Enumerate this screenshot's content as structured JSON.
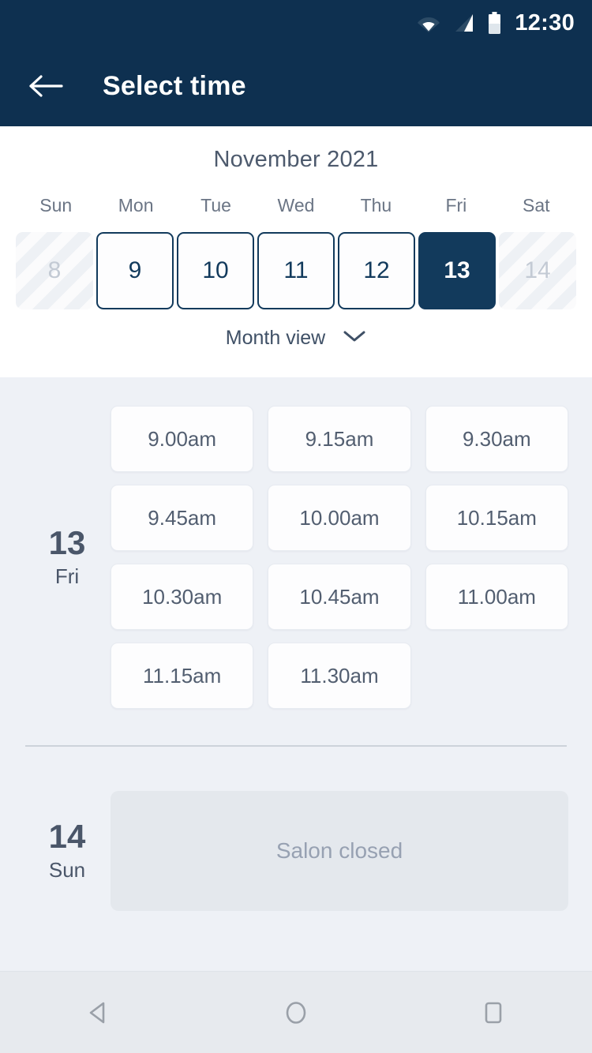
{
  "status_bar": {
    "time": "12:30",
    "icons": [
      "wifi-icon",
      "signal-icon",
      "battery-icon"
    ]
  },
  "app_bar": {
    "back_icon": "arrow-left-icon",
    "title": "Select time"
  },
  "calendar": {
    "month_label": "November 2021",
    "weekdays": [
      "Sun",
      "Mon",
      "Tue",
      "Wed",
      "Thu",
      "Fri",
      "Sat"
    ],
    "dates": [
      {
        "day": "8",
        "state": "disabled"
      },
      {
        "day": "9",
        "state": "outlined"
      },
      {
        "day": "10",
        "state": "outlined"
      },
      {
        "day": "11",
        "state": "outlined"
      },
      {
        "day": "12",
        "state": "outlined"
      },
      {
        "day": "13",
        "state": "selected"
      },
      {
        "day": "14",
        "state": "disabled"
      }
    ],
    "view_toggle_label": "Month view",
    "view_toggle_icon": "chevron-down-icon"
  },
  "schedule": [
    {
      "day_number": "13",
      "day_name": "Fri",
      "slots": [
        "9.00am",
        "9.15am",
        "9.30am",
        "9.45am",
        "10.00am",
        "10.15am",
        "10.30am",
        "10.45am",
        "11.00am",
        "11.15am",
        "11.30am"
      ]
    },
    {
      "day_number": "14",
      "day_name": "Sun",
      "closed_message": "Salon closed"
    }
  ],
  "nav_bar": {
    "back": "back-triangle-icon",
    "home": "home-circle-icon",
    "recents": "recents-square-icon"
  },
  "colors": {
    "brand_navy": "#0e3050",
    "selected_navy": "#123a5c",
    "page_bg": "#eef1f6",
    "card_bg": "#fdfdfe",
    "closed_bg": "#e4e8ed",
    "text_slate": "#4a5669",
    "text_muted": "#97a1b2"
  }
}
